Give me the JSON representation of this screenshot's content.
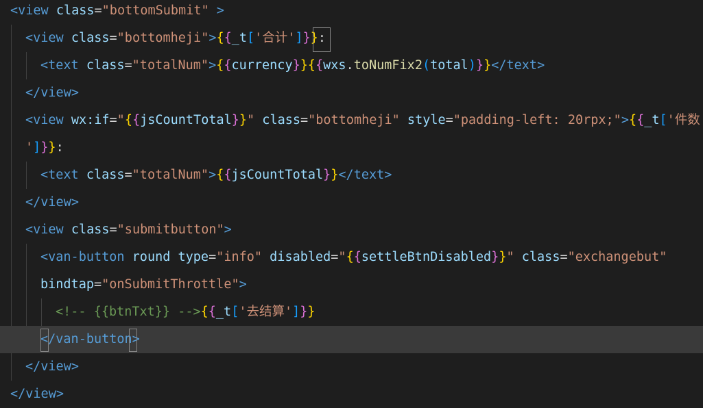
{
  "editor": {
    "lines": [
      {
        "tokens": [
          {
            "t": "<",
            "c": "c-tag"
          },
          {
            "t": "view",
            "c": "c-tag"
          },
          {
            "t": " class",
            "c": "c-attr"
          },
          {
            "t": "=",
            "c": "c-punct"
          },
          {
            "t": "\"bottomSubmit\"",
            "c": "c-str"
          },
          {
            "t": " ",
            "c": "c-punct"
          },
          {
            "t": ">",
            "c": "c-tag"
          }
        ]
      },
      {
        "tokens": [
          {
            "t": "<",
            "c": "c-tag"
          },
          {
            "t": "view",
            "c": "c-tag"
          },
          {
            "t": " class",
            "c": "c-attr"
          },
          {
            "t": "=",
            "c": "c-punct"
          },
          {
            "t": "\"bottomheji\"",
            "c": "c-str"
          },
          {
            "t": ">",
            "c": "c-tag"
          },
          {
            "t": "{",
            "c": "c-br1"
          },
          {
            "t": "{",
            "c": "c-br2"
          },
          {
            "t": "_t",
            "c": "c-var"
          },
          {
            "t": "[",
            "c": "c-br3"
          },
          {
            "t": "'合计'",
            "c": "c-sstr"
          },
          {
            "t": "]",
            "c": "c-br3"
          },
          {
            "t": "}",
            "c": "c-br2"
          },
          {
            "t": "}",
            "c": "c-br1"
          },
          {
            "t": ":",
            "c": "c-punct"
          }
        ]
      },
      {
        "tokens": [
          {
            "t": "<",
            "c": "c-tag"
          },
          {
            "t": "text",
            "c": "c-tag"
          },
          {
            "t": " class",
            "c": "c-attr"
          },
          {
            "t": "=",
            "c": "c-punct"
          },
          {
            "t": "\"totalNum\"",
            "c": "c-str"
          },
          {
            "t": ">",
            "c": "c-tag"
          },
          {
            "t": "{",
            "c": "c-br1"
          },
          {
            "t": "{",
            "c": "c-br2"
          },
          {
            "t": "currency",
            "c": "c-var"
          },
          {
            "t": "}",
            "c": "c-br2"
          },
          {
            "t": "}",
            "c": "c-br1"
          },
          {
            "t": "{",
            "c": "c-br1"
          },
          {
            "t": "{",
            "c": "c-br2"
          },
          {
            "t": "wxs",
            "c": "c-var"
          },
          {
            "t": ".",
            "c": "c-punct"
          },
          {
            "t": "toNumFix2",
            "c": "c-fn"
          },
          {
            "t": "(",
            "c": "c-br3"
          },
          {
            "t": "total",
            "c": "c-var"
          },
          {
            "t": ")",
            "c": "c-br3"
          },
          {
            "t": "}",
            "c": "c-br2"
          },
          {
            "t": "}",
            "c": "c-br1"
          },
          {
            "t": "</",
            "c": "c-tag"
          },
          {
            "t": "text",
            "c": "c-tag"
          },
          {
            "t": ">",
            "c": "c-tag"
          }
        ]
      },
      {
        "tokens": [
          {
            "t": "</",
            "c": "c-tag"
          },
          {
            "t": "view",
            "c": "c-tag"
          },
          {
            "t": ">",
            "c": "c-tag"
          }
        ]
      },
      {
        "tokens": [
          {
            "t": "<",
            "c": "c-tag"
          },
          {
            "t": "view",
            "c": "c-tag"
          },
          {
            "t": " wx:if",
            "c": "c-attr"
          },
          {
            "t": "=",
            "c": "c-punct"
          },
          {
            "t": "\"",
            "c": "c-str"
          },
          {
            "t": "{",
            "c": "c-br1"
          },
          {
            "t": "{",
            "c": "c-br2"
          },
          {
            "t": "jsCountTotal",
            "c": "c-var"
          },
          {
            "t": "}",
            "c": "c-br2"
          },
          {
            "t": "}",
            "c": "c-br1"
          },
          {
            "t": "\"",
            "c": "c-str"
          },
          {
            "t": " class",
            "c": "c-attr"
          },
          {
            "t": "=",
            "c": "c-punct"
          },
          {
            "t": "\"bottomheji\"",
            "c": "c-str"
          },
          {
            "t": " style",
            "c": "c-attr"
          },
          {
            "t": "=",
            "c": "c-punct"
          },
          {
            "t": "\"padding-left: 20rpx;\"",
            "c": "c-str"
          },
          {
            "t": ">",
            "c": "c-tag"
          },
          {
            "t": "{",
            "c": "c-br1"
          },
          {
            "t": "{",
            "c": "c-br2"
          },
          {
            "t": "_t",
            "c": "c-var"
          },
          {
            "t": "[",
            "c": "c-br3"
          },
          {
            "t": "'件数",
            "c": "c-sstr"
          }
        ]
      },
      {
        "tokens": [
          {
            "t": "'",
            "c": "c-sstr"
          },
          {
            "t": "]",
            "c": "c-br3"
          },
          {
            "t": "}",
            "c": "c-br2"
          },
          {
            "t": "}",
            "c": "c-br1"
          },
          {
            "t": ":",
            "c": "c-punct"
          }
        ]
      },
      {
        "tokens": [
          {
            "t": "<",
            "c": "c-tag"
          },
          {
            "t": "text",
            "c": "c-tag"
          },
          {
            "t": " class",
            "c": "c-attr"
          },
          {
            "t": "=",
            "c": "c-punct"
          },
          {
            "t": "\"totalNum\"",
            "c": "c-str"
          },
          {
            "t": ">",
            "c": "c-tag"
          },
          {
            "t": "{",
            "c": "c-br1"
          },
          {
            "t": "{",
            "c": "c-br2"
          },
          {
            "t": "jsCountTotal",
            "c": "c-var"
          },
          {
            "t": "}",
            "c": "c-br2"
          },
          {
            "t": "}",
            "c": "c-br1"
          },
          {
            "t": "</",
            "c": "c-tag"
          },
          {
            "t": "text",
            "c": "c-tag"
          },
          {
            "t": ">",
            "c": "c-tag"
          }
        ]
      },
      {
        "tokens": [
          {
            "t": "</",
            "c": "c-tag"
          },
          {
            "t": "view",
            "c": "c-tag"
          },
          {
            "t": ">",
            "c": "c-tag"
          }
        ]
      },
      {
        "tokens": [
          {
            "t": "<",
            "c": "c-tag"
          },
          {
            "t": "view",
            "c": "c-tag"
          },
          {
            "t": " class",
            "c": "c-attr"
          },
          {
            "t": "=",
            "c": "c-punct"
          },
          {
            "t": "\"submitbutton\"",
            "c": "c-str"
          },
          {
            "t": ">",
            "c": "c-tag"
          }
        ]
      },
      {
        "tokens": [
          {
            "t": "<",
            "c": "c-tag"
          },
          {
            "t": "van-button",
            "c": "c-tag"
          },
          {
            "t": " round",
            "c": "c-attr"
          },
          {
            "t": " type",
            "c": "c-attr"
          },
          {
            "t": "=",
            "c": "c-punct"
          },
          {
            "t": "\"info\"",
            "c": "c-str"
          },
          {
            "t": " disabled",
            "c": "c-attr"
          },
          {
            "t": "=",
            "c": "c-punct"
          },
          {
            "t": "\"",
            "c": "c-str"
          },
          {
            "t": "{",
            "c": "c-br1"
          },
          {
            "t": "{",
            "c": "c-br2"
          },
          {
            "t": "settleBtnDisabled",
            "c": "c-var"
          },
          {
            "t": "}",
            "c": "c-br2"
          },
          {
            "t": "}",
            "c": "c-br1"
          },
          {
            "t": "\"",
            "c": "c-str"
          },
          {
            "t": " class",
            "c": "c-attr"
          },
          {
            "t": "=",
            "c": "c-punct"
          },
          {
            "t": "\"exchangebut\"",
            "c": "c-str"
          }
        ]
      },
      {
        "tokens": [
          {
            "t": "bindtap",
            "c": "c-attr"
          },
          {
            "t": "=",
            "c": "c-punct"
          },
          {
            "t": "\"onSubmitThrottle\"",
            "c": "c-str"
          },
          {
            "t": ">",
            "c": "c-tag"
          }
        ]
      },
      {
        "tokens": [
          {
            "t": "<!-- {{btnTxt}} -->",
            "c": "c-cmt"
          },
          {
            "t": "{",
            "c": "c-br1"
          },
          {
            "t": "{",
            "c": "c-br2"
          },
          {
            "t": "_t",
            "c": "c-var"
          },
          {
            "t": "[",
            "c": "c-br3"
          },
          {
            "t": "'去结算'",
            "c": "c-sstr"
          },
          {
            "t": "]",
            "c": "c-br3"
          },
          {
            "t": "}",
            "c": "c-br2"
          },
          {
            "t": "}",
            "c": "c-br1"
          }
        ]
      },
      {
        "tokens": [
          {
            "t": "</",
            "c": "c-tag"
          },
          {
            "t": "van-button",
            "c": "c-tag"
          },
          {
            "t": ">",
            "c": "c-tag"
          }
        ]
      },
      {
        "tokens": [
          {
            "t": "</",
            "c": "c-tag"
          },
          {
            "t": "view",
            "c": "c-tag"
          },
          {
            "t": ">",
            "c": "c-tag"
          }
        ]
      },
      {
        "tokens": [
          {
            "t": "</",
            "c": "c-tag"
          },
          {
            "t": "view",
            "c": "c-tag"
          },
          {
            "t": ">",
            "c": "c-tag"
          }
        ]
      }
    ],
    "current_line": 12,
    "colors": {
      "background": "#1e1e1e",
      "current_line": "#3a3a3a",
      "tag": "#569cd6",
      "attribute": "#9cdcfe",
      "string": "#ce9178",
      "comment": "#6a9955",
      "function": "#dcdcaa",
      "bracket_gold": "#ffd700",
      "bracket_purple": "#da70d6",
      "bracket_blue": "#179fff"
    }
  }
}
